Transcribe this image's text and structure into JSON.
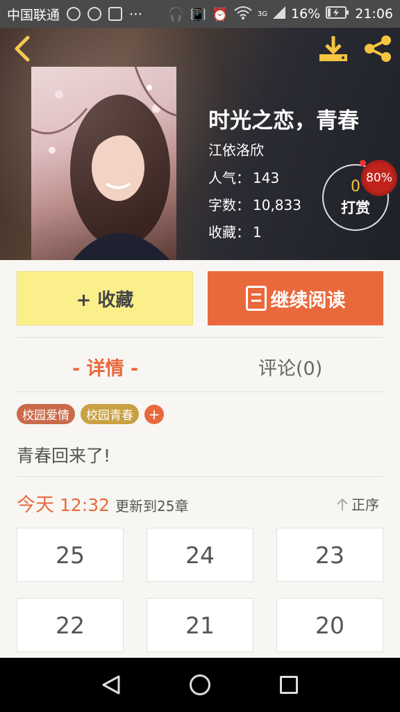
{
  "status_bar": {
    "carrier": "中国联通",
    "extra_icons": "⋯",
    "signal_label": "3G",
    "battery": "16%",
    "time": "21:06"
  },
  "book": {
    "title": "时光之恋，青春",
    "author": "江依洛欣",
    "popularity_label": "人气：",
    "popularity": "143",
    "words_label": "字数：",
    "words": "10,833",
    "favorites_label": "收藏：",
    "favorites": "1"
  },
  "tip": {
    "count": "0",
    "label": "打赏",
    "badge": "80%"
  },
  "actions": {
    "favorite": "+ 收藏",
    "continue_reading": "继续阅读"
  },
  "tabs": {
    "details": "- 详情 -",
    "comments": "评论(0)"
  },
  "tags": [
    "校园爱情",
    "校园青春"
  ],
  "tag_add": "+",
  "summary": "青春回来了!",
  "update": {
    "day": "今天",
    "time": "12:32",
    "text": "更新到25章",
    "sort": "正序"
  },
  "chapters": [
    "25",
    "24",
    "23",
    "22",
    "21",
    "20"
  ],
  "colors": {
    "accent": "#e9693c",
    "favorite_button": "#fbef8c",
    "tag_love": "#c96a4a",
    "tag_youth": "#c9a042",
    "tip_count": "#f5c542"
  }
}
